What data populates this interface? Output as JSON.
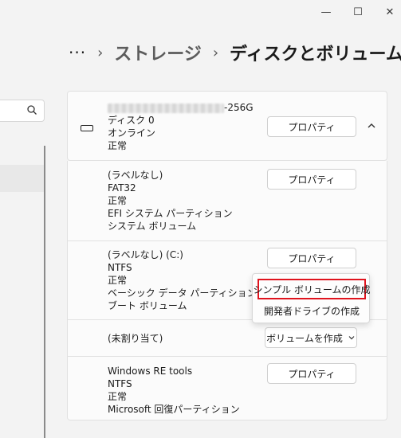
{
  "titlebar": {
    "minimize": "—",
    "maximize": "☐",
    "close": "✕"
  },
  "breadcrumb": {
    "more": "···",
    "sep": "›",
    "parent": "ストレージ",
    "current": "ディスクとボリューム"
  },
  "disk": {
    "name_suffix": "-256G",
    "label": "ディスク 0",
    "state": "オンライン",
    "health": "正常",
    "button": "プロパティ"
  },
  "volumes": [
    {
      "lines": [
        "(ラベルなし)",
        "FAT32",
        "正常",
        "EFI システム パーティション",
        "システム ボリューム"
      ],
      "button": "プロパティ"
    },
    {
      "lines": [
        "(ラベルなし) (C:)",
        "NTFS",
        "正常",
        "ベーシック データ パーティション",
        "ブート ボリューム"
      ],
      "button": "プロパティ"
    },
    {
      "lines": [
        "(未割り当て)"
      ],
      "button": "ボリュームを作成"
    },
    {
      "lines": [
        "Windows RE tools",
        "NTFS",
        "正常",
        "Microsoft 回復パーティション"
      ],
      "button": "プロパティ"
    }
  ],
  "menu": {
    "items": [
      "シンプル ボリュームの作成",
      "開発者ドライブの作成"
    ],
    "highlight_color": "#e0141e"
  }
}
